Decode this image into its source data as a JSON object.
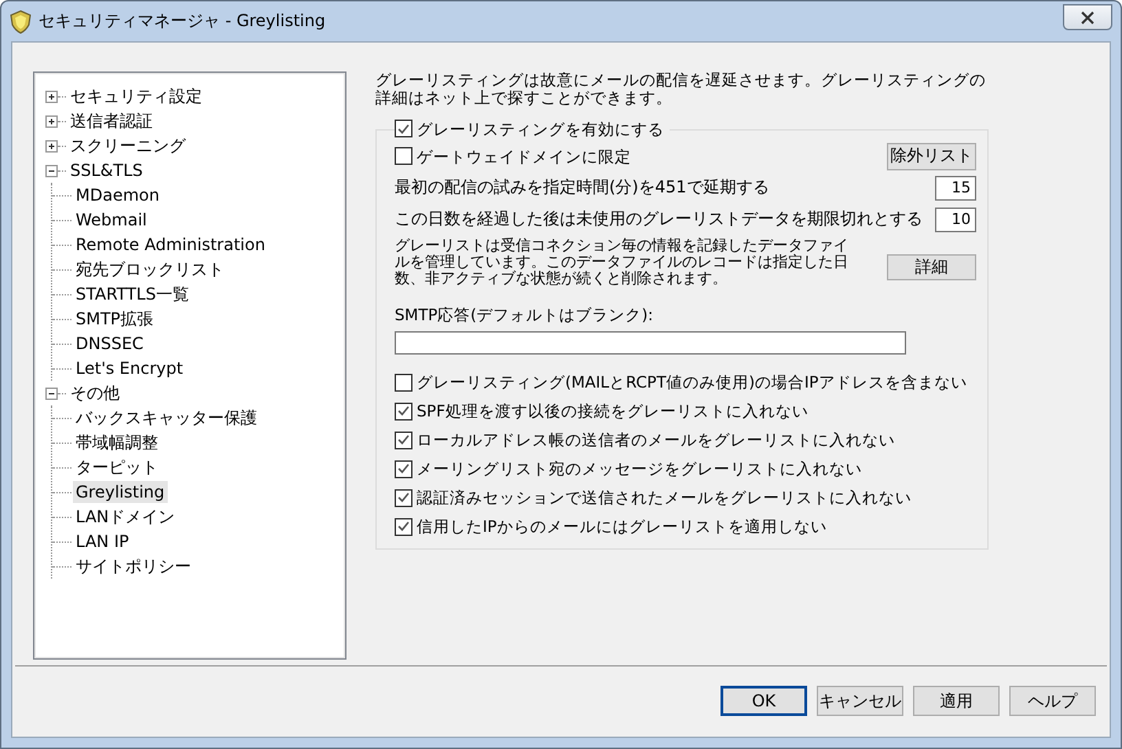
{
  "window": {
    "title": "セキュリティマネージャ - Greylisting"
  },
  "tree": [
    {
      "label": "セキュリティ設定",
      "expanded": false,
      "selected": false
    },
    {
      "label": "送信者認証",
      "expanded": false,
      "selected": false
    },
    {
      "label": "スクリーニング",
      "expanded": false,
      "selected": false
    },
    {
      "label": "SSL&TLS",
      "expanded": true,
      "selected": false,
      "children": [
        {
          "label": "MDaemon",
          "selected": false
        },
        {
          "label": "Webmail",
          "selected": false
        },
        {
          "label": "Remote Administration",
          "selected": false
        },
        {
          "label": "宛先ブロックリスト",
          "selected": false
        },
        {
          "label": "STARTTLS一覧",
          "selected": false
        },
        {
          "label": "SMTP拡張",
          "selected": false
        },
        {
          "label": "DNSSEC",
          "selected": false
        },
        {
          "label": "Let's Encrypt",
          "selected": false
        }
      ]
    },
    {
      "label": "その他",
      "expanded": true,
      "selected": false,
      "children": [
        {
          "label": "バックスキャッター保護",
          "selected": false
        },
        {
          "label": "帯域幅調整",
          "selected": false
        },
        {
          "label": "ターピット",
          "selected": false
        },
        {
          "label": "Greylisting",
          "selected": true
        },
        {
          "label": "LANドメイン",
          "selected": false
        },
        {
          "label": "LAN IP",
          "selected": false
        },
        {
          "label": "サイトポリシー",
          "selected": false
        }
      ]
    }
  ],
  "description": "グレーリスティングは故意にメールの配信を遅延させます。グレーリスティングの詳細はネット上で探すことができます。",
  "group": {
    "enable": {
      "label": "グレーリスティングを有効にする",
      "checked": true
    },
    "gateway": {
      "label": "ゲートウェイドメインに限定",
      "checked": false,
      "button": "除外リスト"
    },
    "numbers": [
      {
        "label": "最初の配信の試みを指定時間(分)を451で延期する",
        "value": "15"
      },
      {
        "label": "この日数を経過した後は未使用のグレーリストデータを期限切れとする",
        "value": "10"
      }
    ],
    "note": {
      "text": "グレーリストは受信コネクション毎の情報を記録したデータファイルを管理しています。このデータファイルのレコードは指定した日数、非アクティブな状態が続くと削除されます。",
      "button": "詳細"
    },
    "smtp_response": {
      "label": "SMTP応答(デフォルトはブランク):"
    },
    "options": [
      {
        "label": "グレーリスティング(MAILとRCPT値のみ使用)の場合IPアドレスを含まない",
        "checked": false
      },
      {
        "label": "SPF処理を渡す以後の接続をグレーリストに入れない",
        "checked": true
      },
      {
        "label": "ローカルアドレス帳の送信者のメールをグレーリストに入れない",
        "checked": true
      },
      {
        "label": "メーリングリスト宛のメッセージをグレーリストに入れない",
        "checked": true
      },
      {
        "label": "認証済みセッションで送信されたメールをグレーリストに入れない",
        "checked": true
      },
      {
        "label": "信用したIPからのメールにはグレーリストを適用しない",
        "checked": true
      }
    ]
  },
  "buttons": [
    {
      "label": "OK",
      "default": true
    },
    {
      "label": "キャンセル",
      "default": false
    },
    {
      "label": "適用",
      "default": false
    },
    {
      "label": "ヘルプ",
      "default": false
    }
  ]
}
